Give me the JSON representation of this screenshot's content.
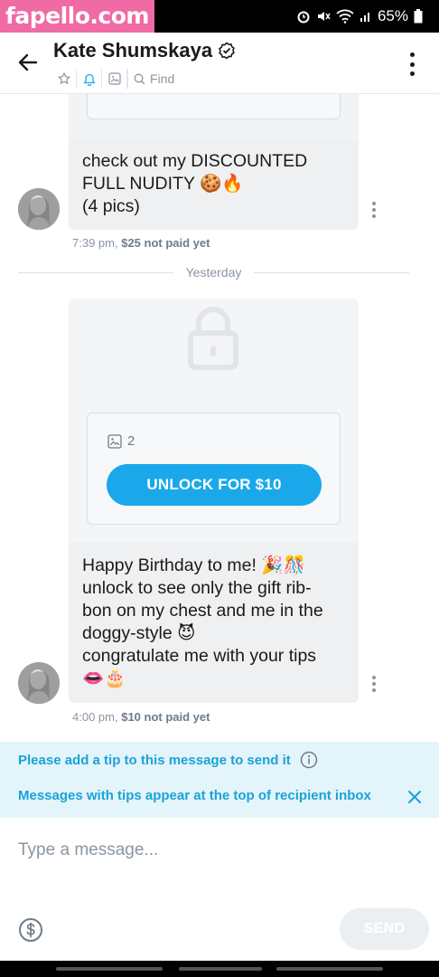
{
  "watermark": "fapello.com",
  "status": {
    "battery": "65%"
  },
  "header": {
    "title": "Kate Shumskaya",
    "find_label": "Find"
  },
  "messages": [
    {
      "text": "check out my DISCOUNTED FULL NUDITY 🍪🔥\n(4 pics)",
      "time": "7:39 pm,",
      "price_status": "$25 not paid yet"
    },
    {
      "media_count": "2",
      "unlock_label": "UNLOCK FOR $10",
      "text": "Happy Birthday to me! 🎉🎊\nunlock to see only the gift rib-\nbon on my chest and me in the\ndoggy-style 😈\ncongratulate me with your tips\n👄🎂",
      "time": "4:00 pm,",
      "price_status": "$10 not paid yet"
    }
  ],
  "date_divider": "Yesterday",
  "tip_banner": {
    "line1": "Please add a tip to this message to send it",
    "line2": "Messages with tips appear at the top of recipient inbox"
  },
  "composer": {
    "placeholder": "Type a message...",
    "send_label": "SEND"
  },
  "colors": {
    "accent": "#1ba8ea",
    "banner_bg": "#e3f4fb",
    "watermark_bg": "#f06aa4"
  }
}
